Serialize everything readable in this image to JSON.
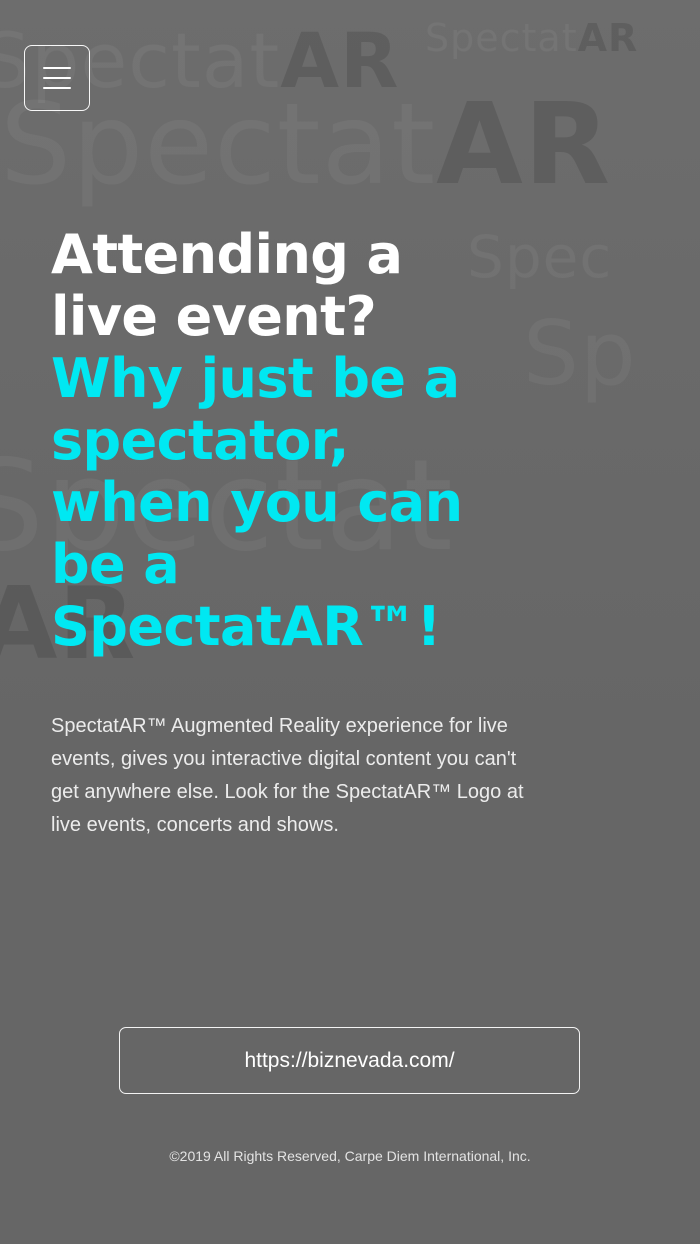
{
  "menu": {
    "icon": "hamburger-icon"
  },
  "hero": {
    "line1": "Attending a",
    "line2": "live event?",
    "line3": "Why just be a",
    "line4": "spectator,",
    "line5": "when you can",
    "line6": "be a",
    "line7": "SpectatAR™!"
  },
  "description": "SpectatAR™ Augmented Reality experience for live events, gives you interactive digital content you can't get anywhere else. Look for the SpectatAR™ Logo at live events, concerts and shows.",
  "cta": {
    "url_label": "https://biznevada.com/"
  },
  "footer": {
    "copyright": "©2019 All Rights Reserved, Carpe Diem International, Inc."
  },
  "colors": {
    "background": "#666666",
    "headline_white": "#ffffff",
    "headline_accent": "#00e8f2"
  }
}
